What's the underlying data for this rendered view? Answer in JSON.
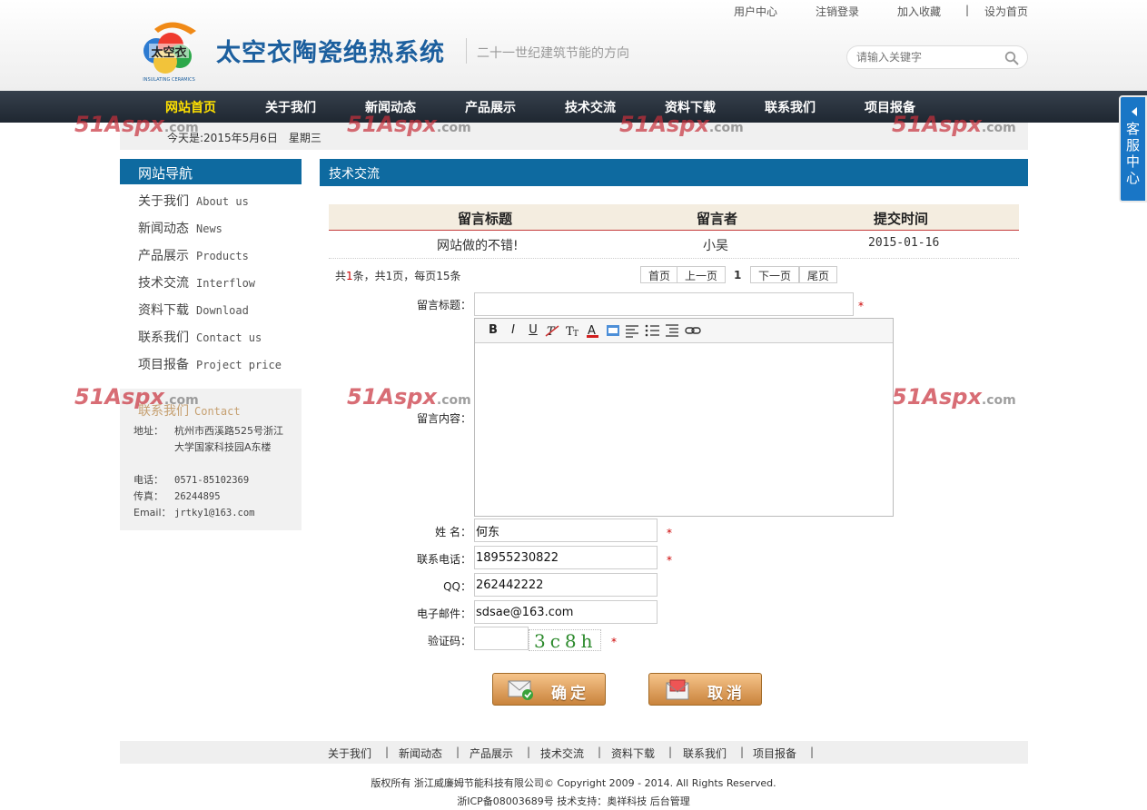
{
  "top_links": [
    "用户中心",
    "注销登录",
    "加入收藏",
    "|",
    "设为首页"
  ],
  "brand": {
    "logo_text": "太空衣",
    "logo_sub": "INSULATING CERAMICS",
    "title": "太空衣陶瓷绝热系统",
    "slogan": "二十一世纪建筑节能的方向"
  },
  "search": {
    "placeholder": "请输入关键字"
  },
  "nav": [
    "网站首页",
    "关于我们",
    "新闻动态",
    "产品展示",
    "技术交流",
    "资料下载",
    "联系我们",
    "项目报备"
  ],
  "date_text": "今天是:2015年5月6日　星期三",
  "watermark": {
    "text": "51Aspx",
    "suffix": ".com"
  },
  "sidebar": {
    "title": "网站导航",
    "items": [
      {
        "cn": "关于我们",
        "en": "About us"
      },
      {
        "cn": "新闻动态",
        "en": "News"
      },
      {
        "cn": "产品展示",
        "en": "Products"
      },
      {
        "cn": "技术交流",
        "en": "Interflow"
      },
      {
        "cn": "资料下载",
        "en": "Download"
      },
      {
        "cn": "联系我们",
        "en": "Contact us"
      },
      {
        "cn": "项目报备",
        "en": "Project price"
      }
    ],
    "contact": {
      "title_cn": "联系我们",
      "title_en": "Contact",
      "address_label": "地址：",
      "address": "杭州市西溪路525号浙江大学国家科技园A东楼",
      "phone_label": "电话：",
      "phone": "0571-85102369",
      "fax_label": "传真：",
      "fax": "26244895",
      "email_label": "Email：",
      "email": "jrtky1@163.com"
    }
  },
  "main": {
    "title": "技术交流",
    "table": {
      "headers": [
        "留言标题",
        "留言者",
        "提交时间"
      ],
      "rows": [
        [
          "网站做的不错!",
          "小吴",
          "2015-01-16"
        ]
      ]
    },
    "pager": {
      "info_prefix": "共",
      "count": "1",
      "info_suffix": "条，共1页，每页15条",
      "first": "首页",
      "prev": "上一页",
      "current": "1",
      "next": "下一页",
      "last": "尾页"
    },
    "form": {
      "title_label": "留言标题：",
      "content_label": "留言内容：",
      "name_label": "姓  名：",
      "name_value": "何东",
      "phone_label": "联系电话：",
      "phone_value": "18955230822",
      "qq_label": "QQ：",
      "qq_value": "262442222",
      "email_label": "电子邮件：",
      "email_value": "sdsae@163.com",
      "captcha_label": "验证码：",
      "captcha_text": "3c8h",
      "required_mark": "*",
      "toolbar": [
        "B",
        "I",
        "U"
      ],
      "submit_label": "确定",
      "cancel_label": "取消"
    }
  },
  "footer": {
    "links": [
      "关于我们",
      "新闻动态",
      "产品展示",
      "技术交流",
      "资料下载",
      "联系我们",
      "项目报备"
    ],
    "separator": "|",
    "copyright": "版权所有 浙江威廉姆节能科技有限公司© Copyright 2009 - 2014. All Rights Reserved.",
    "icp": "浙ICP备08003689号 技术支持：奥祥科技 后台管理"
  },
  "service": {
    "label": "客服中心"
  }
}
